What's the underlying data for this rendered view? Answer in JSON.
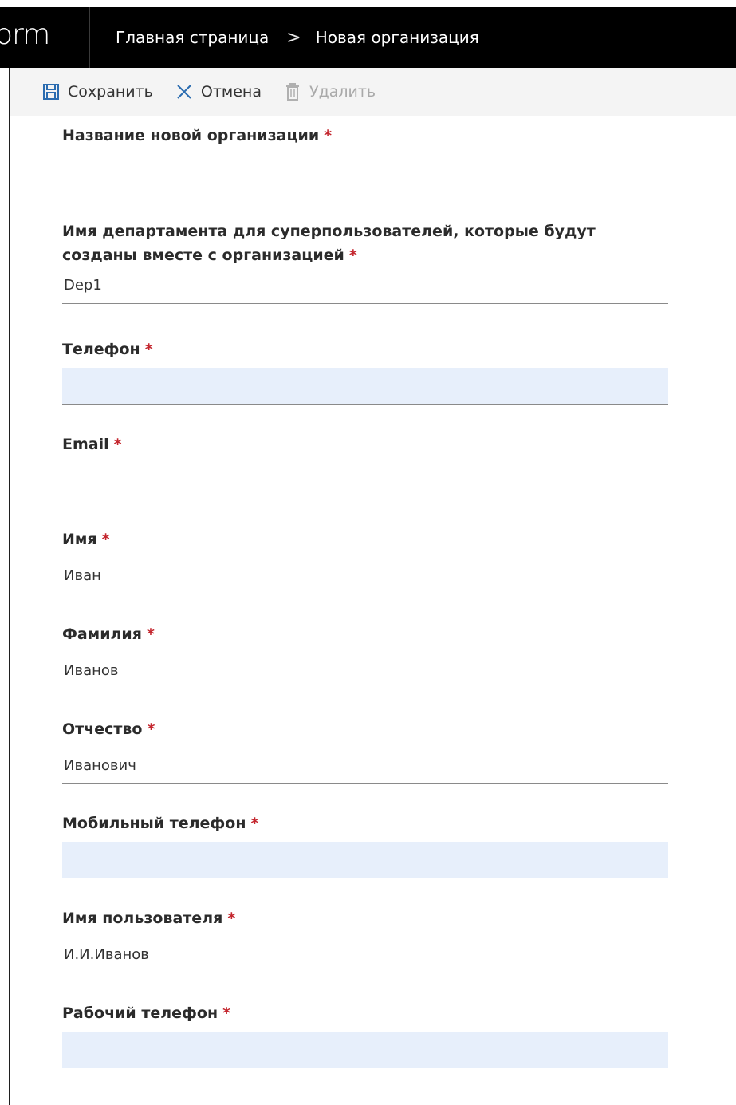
{
  "app": {
    "logo_text": "orm"
  },
  "breadcrumb": {
    "home": "Главная страница",
    "separator": ">",
    "current": "Новая организация"
  },
  "toolbar": {
    "save_label": "Сохранить",
    "cancel_label": "Отмена",
    "delete_label": "Удалить"
  },
  "colors": {
    "topbar": "#000000",
    "required_star": "#c4262e",
    "empty_required_field": "#e7effb",
    "focus_underline": "#2b88d8"
  },
  "form": {
    "required_marker": "*",
    "fields": [
      {
        "label": "Название новой организации",
        "value": ""
      },
      {
        "label": "Имя департамента для суперпользователей, которые будут созданы вместе с организацией",
        "value": "Dep1"
      },
      {
        "label": "Телефон",
        "value": ""
      },
      {
        "label": "Email",
        "value": ""
      },
      {
        "label": "Имя",
        "value": "Иван"
      },
      {
        "label": "Фамилия",
        "value": "Иванов"
      },
      {
        "label": "Отчество",
        "value": "Иванович"
      },
      {
        "label": "Мобильный телефон",
        "value": ""
      },
      {
        "label": "Имя пользователя",
        "value": "И.И.Иванов"
      },
      {
        "label": "Рабочий телефон",
        "value": ""
      }
    ]
  }
}
